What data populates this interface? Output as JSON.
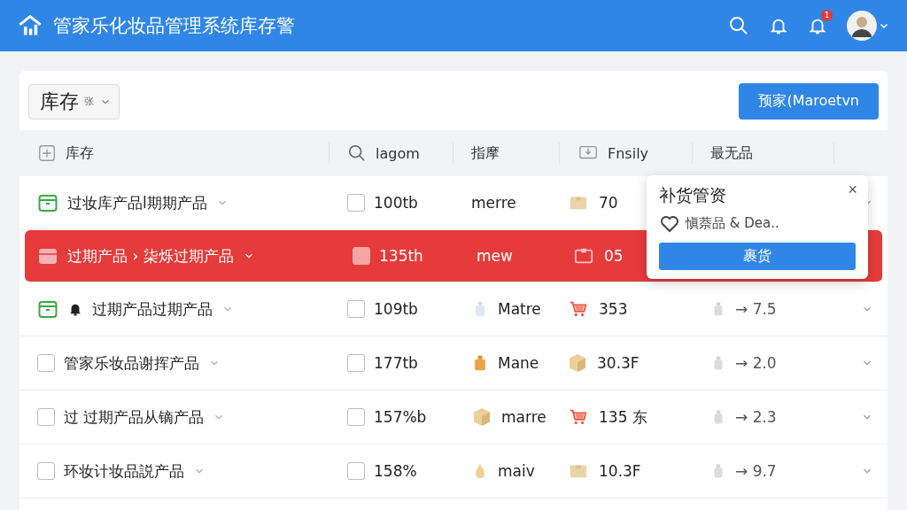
{
  "app_bar": {
    "title": "管家乐化妆品管理系统库存警",
    "badge": "1"
  },
  "toolbar": {
    "select": {
      "value": "库存",
      "hint": "张"
    },
    "button": "预家(Maroetvn"
  },
  "table": {
    "columns": [
      {
        "kind": "plus",
        "label": "库存"
      },
      {
        "kind": "search",
        "label": "lagom"
      },
      {
        "kind": "plain",
        "label": "指摩"
      },
      {
        "kind": "monitor",
        "label": "Fnsily"
      },
      {
        "kind": "plain",
        "label": "最无品"
      }
    ],
    "rows": [
      {
        "kind": "box",
        "selected": false,
        "alert": false,
        "name": "过妆库产品l期期产品",
        "qty_checked": false,
        "qty": "100tb",
        "type": {
          "kind": "plain",
          "text": "merre"
        },
        "stock": {
          "kind": "box",
          "text": "70"
        }
      },
      {
        "kind": "box",
        "selected": true,
        "alert": false,
        "name": "过期产品 › 柒烁过期产品",
        "qty_checked": true,
        "qty": "135th",
        "type": {
          "kind": "plain",
          "text": "mew"
        },
        "stock": {
          "kind": "box",
          "text": "05"
        }
      },
      {
        "kind": "box",
        "selected": false,
        "alert": true,
        "name": "过期产品过期产品",
        "qty_checked": false,
        "qty": "109tb",
        "type": {
          "kind": "bottle",
          "text": "Matre"
        },
        "stock": {
          "kind": "cart",
          "text": "353"
        },
        "trend": "→ 7.5"
      },
      {
        "kind": "checkbox",
        "selected": false,
        "alert": false,
        "checked": false,
        "name": "管家乐妆品谢挥产品",
        "qty_checked": false,
        "qty": "177tb",
        "type": {
          "kind": "jar",
          "text": "Mane"
        },
        "stock": {
          "kind": "cube",
          "text": "30.3F"
        },
        "trend": "→ 2.0"
      },
      {
        "kind": "checkbox",
        "selected": false,
        "alert": false,
        "checked": false,
        "name": "过 过期产品从镝产品",
        "qty_checked": false,
        "qty": "157%b",
        "type": {
          "kind": "cube",
          "text": "marre"
        },
        "stock": {
          "kind": "cart",
          "text": "135 东"
        },
        "trend": "→ 2.3"
      },
      {
        "kind": "checkbox",
        "selected": false,
        "alert": false,
        "checked": false,
        "name": "环妆计妆品説产品",
        "qty_checked": false,
        "qty": "158%",
        "type": {
          "kind": "drop",
          "text": "maiv"
        },
        "stock": {
          "kind": "box",
          "text": "10.3F"
        },
        "trend": "→ 9.7"
      }
    ]
  },
  "popover": {
    "title": "补货管资",
    "close": "×",
    "item": "愼萘品 & Dea..",
    "button": "裹货"
  }
}
